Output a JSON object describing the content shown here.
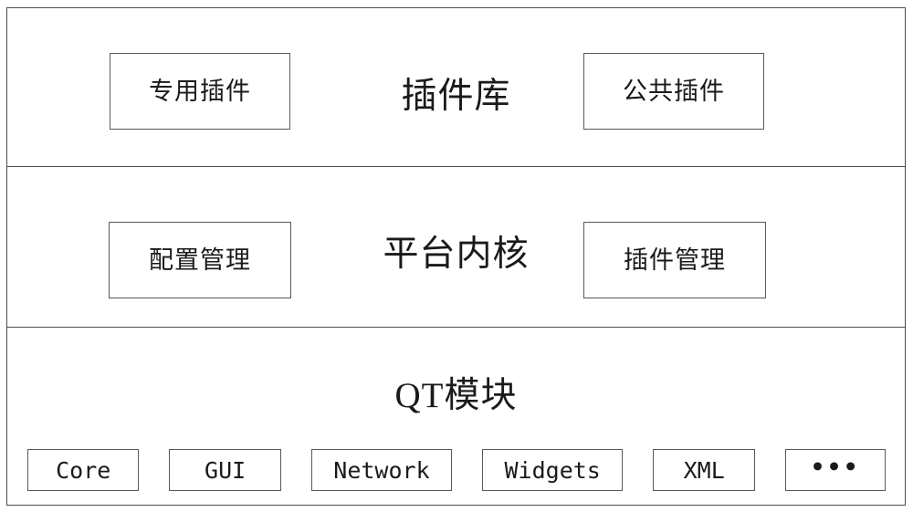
{
  "diagram": {
    "kind": "layered-architecture",
    "layers": [
      {
        "id": "plugin-library",
        "title": "插件库",
        "left_box": "专用插件",
        "right_box": "公共插件"
      },
      {
        "id": "platform-kernel",
        "title": "平台内核",
        "left_box": "配置管理",
        "right_box": "插件管理"
      },
      {
        "id": "qt-module",
        "title": "QT模块",
        "modules": [
          "Core",
          "GUI",
          "Network",
          "Widgets",
          "XML",
          "•••"
        ]
      }
    ]
  },
  "colors": {
    "background": "#ffffff",
    "frame_border": "#4d4d4d",
    "box_border": "#595959",
    "text": "#1a1a1a"
  }
}
